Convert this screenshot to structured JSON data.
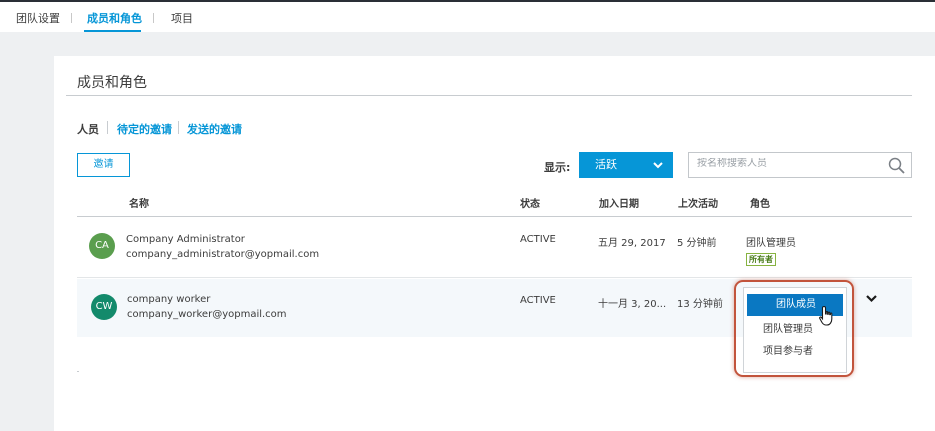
{
  "topnav": {
    "tabs": [
      {
        "label": "团队设置"
      },
      {
        "label": "成员和角色"
      },
      {
        "label": "项目"
      }
    ]
  },
  "page": {
    "title": "成员和角色"
  },
  "subtabs": [
    {
      "label": "人员"
    },
    {
      "label": "待定的邀请"
    },
    {
      "label": "发送的邀请"
    }
  ],
  "toolbar": {
    "invite_label": "邀请",
    "status_label": "显示:",
    "status_value": "活跃",
    "search_placeholder": "按名称搜索人员"
  },
  "table": {
    "headers": {
      "name": "名称",
      "status": "状态",
      "joined": "加入日期",
      "last_active": "上次活动",
      "role": "角色"
    },
    "rows": [
      {
        "initials": "CA",
        "avatar_color": "#5a9e4e",
        "name": "Company Administrator",
        "email": "company_administrator@yopmail.com",
        "status": "ACTIVE",
        "joined": "五月 29, 2017",
        "last_active": "5 分钟前",
        "role": "团队管理员",
        "badge": "所有者"
      },
      {
        "initials": "CW",
        "avatar_color": "#138a6b",
        "name": "company worker",
        "email": "company_worker@yopmail.com",
        "status": "ACTIVE",
        "joined": "十一月 3, 20...",
        "last_active": "13 分钟前"
      }
    ]
  },
  "role_dropdown": {
    "options": [
      {
        "label": "团队成员",
        "selected": true
      },
      {
        "label": "团队管理员",
        "selected": false
      },
      {
        "label": "项目参与者",
        "selected": false
      }
    ]
  },
  "colors": {
    "accent": "#0696d7",
    "highlight": "#c2543c",
    "owner_badge": "#87b340"
  }
}
